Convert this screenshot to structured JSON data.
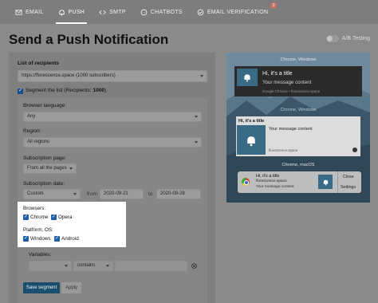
{
  "nav": {
    "tabs": [
      {
        "label": "EMAIL",
        "icon": "envelope-icon"
      },
      {
        "label": "PUSH",
        "icon": "bell-icon",
        "active": true
      },
      {
        "label": "SMTP",
        "icon": "code-icon"
      },
      {
        "label": "CHATBOTS",
        "icon": "chat-icon"
      },
      {
        "label": "EMAIL VERIFICATION",
        "icon": "check-circle-icon",
        "badge": "2"
      }
    ]
  },
  "page": {
    "title": "Send a Push Notification",
    "ab_testing": "A/B Testing"
  },
  "recipients": {
    "label": "List of recipients",
    "selected": "https://florescence.space (1000 subscribers)",
    "segment_label": "Segment the list (Recipients: ",
    "segment_count": "1000",
    "segment_suffix": ")"
  },
  "segment": {
    "browser_language": {
      "label": "Browser language:",
      "value": "Any"
    },
    "region": {
      "label": "Region:",
      "value": "All regions"
    },
    "subscription_page": {
      "label": "Subscription page:",
      "value": "From all the pages"
    },
    "subscription_date": {
      "label": "Subscription date:",
      "value": "Custom",
      "from_label": "from",
      "from": "2020-09-21",
      "to_label": "to",
      "to": "2020-09-28"
    },
    "browsers": {
      "label": "Browsers:",
      "options": [
        "Chrome",
        "Opera"
      ]
    },
    "platform": {
      "label": "Platform, OS:",
      "options": [
        "Windows",
        "Android"
      ]
    },
    "variables": {
      "label": "Variables:",
      "operator": "contains"
    },
    "save_button": "Save segment",
    "apply_button": "Apply"
  },
  "preview": {
    "windows_label": "Chrome, Windows",
    "android_label": "Chrome, Windows",
    "mac_label": "Chrome, macOS",
    "notif_title": "Hi, it's a title",
    "notif_message": "Your message content",
    "windows_source": "Google Chrome • florescence.space",
    "android_source": "florescence.space",
    "mac_domain": "florescence.space",
    "mac_close": "Close",
    "mac_settings": "Settings"
  },
  "colors": {
    "primary_button": "#1b4e6e",
    "checkbox": "#1f4d8a",
    "badge": "#c9706a"
  }
}
